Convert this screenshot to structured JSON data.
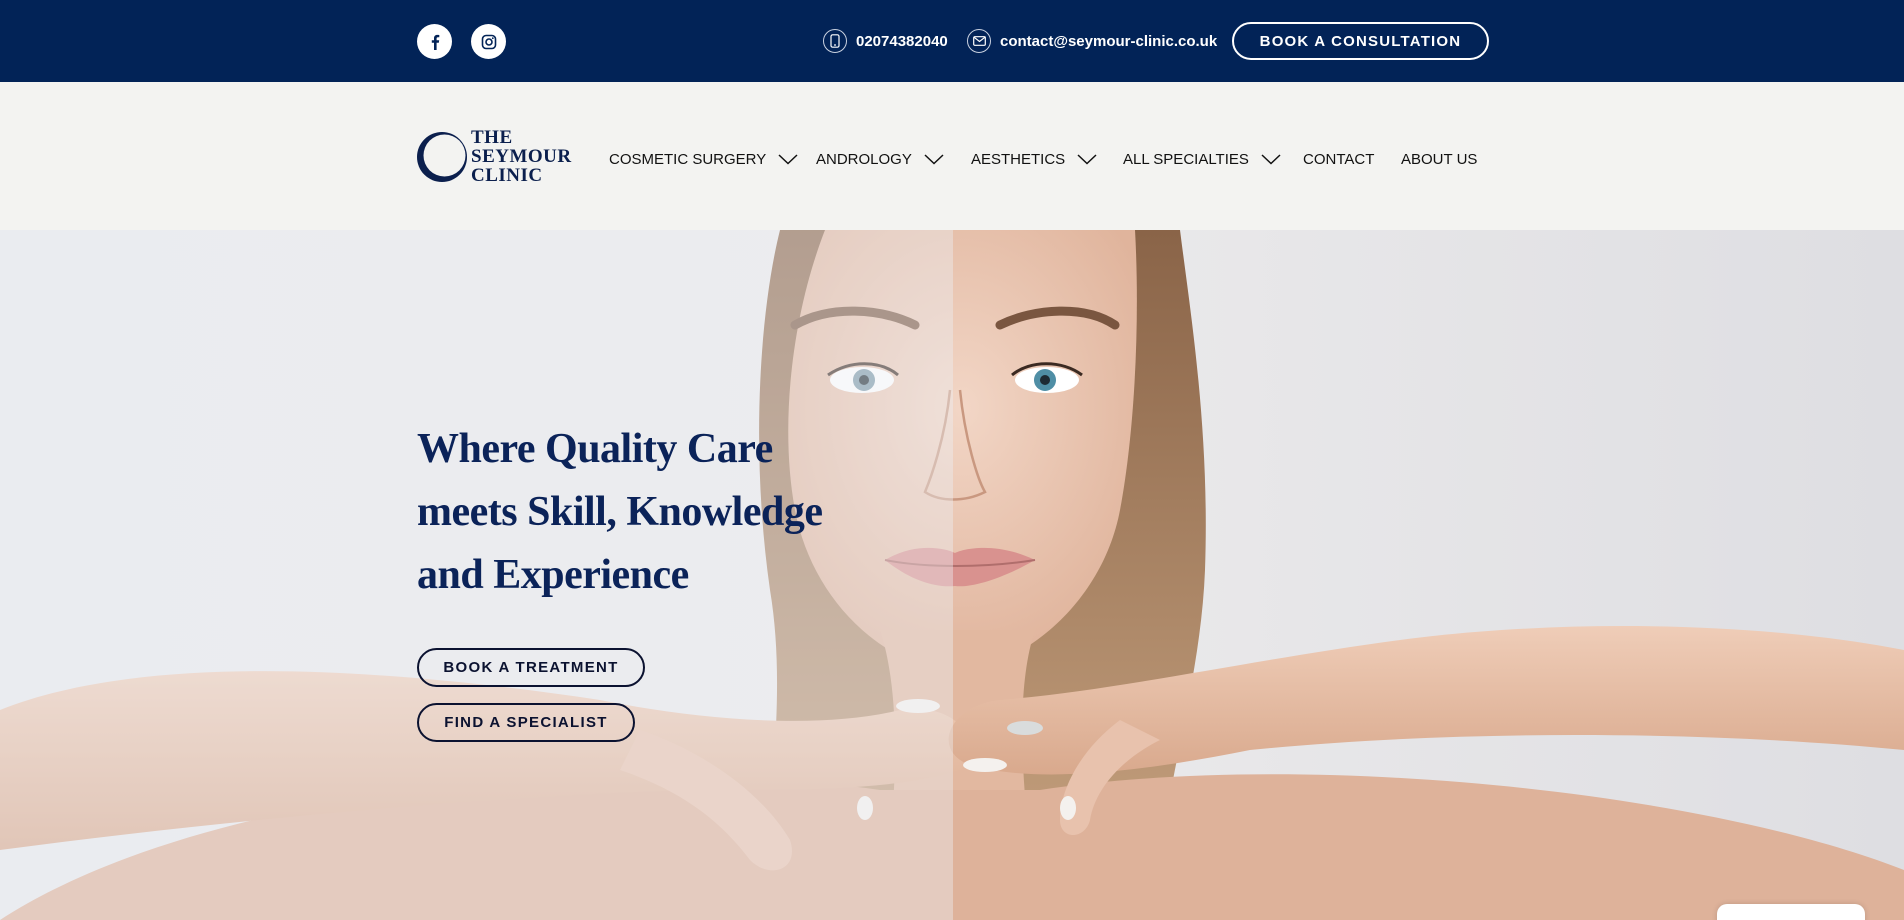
{
  "topbar": {
    "social": [
      {
        "name": "facebook-icon"
      },
      {
        "name": "instagram-icon"
      }
    ],
    "phone": "02074382040",
    "email": "contact@seymour-clinic.co.uk",
    "cta_label": "BOOK A CONSULTATION",
    "background": "#022357"
  },
  "logo": {
    "line1": "THE",
    "line2": "SEYMOUR",
    "line3": "CLINIC"
  },
  "nav": {
    "items": [
      {
        "label": "COSMETIC SURGERY",
        "dropdown": true
      },
      {
        "label": "ANDROLOGY",
        "dropdown": true
      },
      {
        "label": "AESTHETICS",
        "dropdown": true
      },
      {
        "label": "ALL SPECIALTIES",
        "dropdown": true
      },
      {
        "label": "CONTACT",
        "dropdown": false
      },
      {
        "label": "ABOUT US",
        "dropdown": false
      }
    ]
  },
  "hero": {
    "headline_lines": [
      "Where Quality Care",
      "meets Skill,  Knowledge",
      "and Experience"
    ],
    "buttons": {
      "treatment": "BOOK A TREATMENT",
      "specialist": "FIND A SPECIALIST"
    }
  },
  "colors": {
    "navy": "#022357",
    "heading": "#0b2359",
    "nav_bg": "#f3f3f1"
  }
}
